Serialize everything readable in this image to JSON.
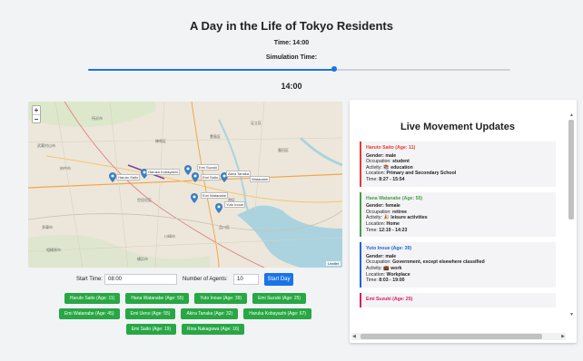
{
  "page": {
    "title": "A Day in the Life of Tokyo Residents",
    "time_label": "Time: 14:00",
    "sim_label": "Simulation Time:",
    "clock": "14:00",
    "slider_fraction": 0.583
  },
  "map": {
    "zoom_in": "+",
    "zoom_out": "−",
    "attribution": "Leaflet",
    "place_labels": [
      "武蔵村山市",
      "多摩市",
      "新宿区",
      "豊島区",
      "川崎市",
      "練馬区",
      "墨田区",
      "足立区",
      "港区",
      "品川区",
      "府中市",
      "世田谷区",
      "所沢市",
      "相模原市",
      "横浜市"
    ],
    "markers": [
      {
        "label": "Haruto Saito"
      },
      {
        "label": "Haruka Kobayashi"
      },
      {
        "label": "Emi Suzuki"
      },
      {
        "label": "Emi Saito"
      },
      {
        "label": "Akira Tanaka"
      },
      {
        "label": "Watanabe"
      },
      {
        "label": "Emi Watanabe"
      },
      {
        "label": "Yuto Inoue"
      }
    ]
  },
  "controls": {
    "start_time_label": "Start Time:",
    "start_time_value": "08:00",
    "agents_label": "Number of Agents:",
    "agents_value": "10",
    "start_button": "Start Day"
  },
  "agent_buttons": [
    [
      "Haruto Saito (Age: 11)",
      "Hana Watanabe (Age: 55)",
      "Yuto Inoue (Age: 39)",
      "Emi Suzuki (Age: 25)"
    ],
    [
      "Emi Watanabe (Age: 45)",
      "Emi Ueno (Age: 55)",
      "Akira Tanaka (Age: 32)",
      "Haruka Kobayashi (Age: 67)"
    ],
    [
      "Emi Saito (Age: 19)",
      "Rina Nakagawa (Age: 16)"
    ]
  ],
  "panel": {
    "title": "Live Movement Updates",
    "cards": [
      {
        "name": "Haruto Saito (Age: 11)",
        "color": "#e53935",
        "gender_label": "Gender:",
        "gender": "male",
        "occupation_label": "Occupation:",
        "occupation": "student",
        "activity_label": "Activity:",
        "activity_icon": "📚",
        "activity": "education",
        "location_label": "Location:",
        "location": "Primary and Secondary School",
        "time_label": "Time:",
        "time": "8:27 - 15:54"
      },
      {
        "name": "Hana Watanabe (Age: 55)",
        "color": "#43a047",
        "gender_label": "Gender:",
        "gender": "female",
        "occupation_label": "Occupation:",
        "occupation": "retiree",
        "activity_label": "Activity:",
        "activity_icon": "🎉",
        "activity": "leisure activities",
        "location_label": "Location:",
        "location": "Home",
        "time_label": "Time:",
        "time": "12:19 - 14:23"
      },
      {
        "name": "Yuto Inoue (Age: 39)",
        "color": "#1e63d6",
        "gender_label": "Gender:",
        "gender": "male",
        "occupation_label": "Occupation:",
        "occupation": "Government, except elsewhere classified",
        "activity_label": "Activity:",
        "activity_icon": "💼",
        "activity": "work",
        "location_label": "Location:",
        "location": "Workplace",
        "time_label": "Time:",
        "time": "8:03 - 19:00"
      },
      {
        "name": "Emi Suzuki (Age: 25)",
        "color": "#d81b60"
      }
    ]
  }
}
